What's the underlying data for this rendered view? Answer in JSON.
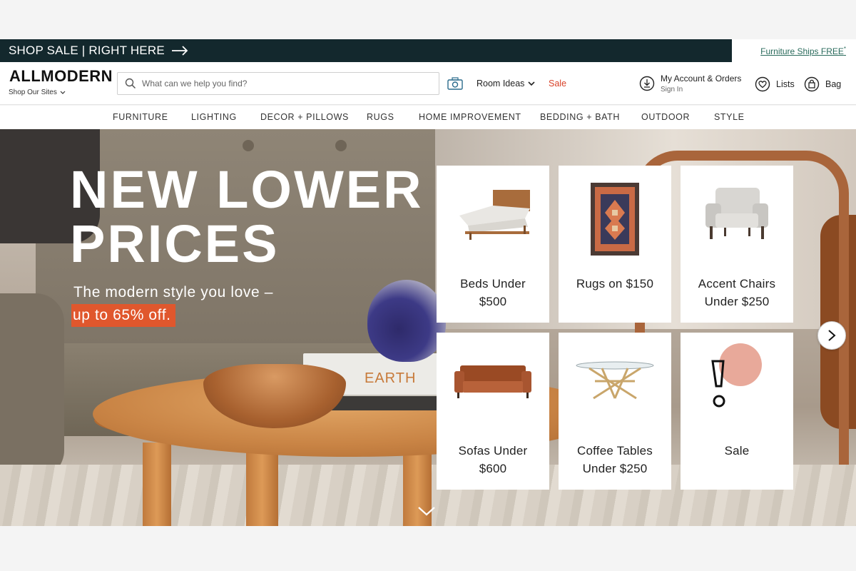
{
  "promo": {
    "left_text": "SHOP SALE | RIGHT HERE",
    "right_text": "Furniture Ships FREE",
    "right_mark": "*"
  },
  "header": {
    "logo": "ALLMODERN",
    "shop_sites": "Shop Our Sites",
    "search_placeholder": "What can we help you find?",
    "room_ideas": "Room Ideas",
    "sale": "Sale",
    "account_title": "My Account & Orders",
    "account_sub": "Sign In",
    "lists": "Lists",
    "bag": "Bag"
  },
  "nav": {
    "items": [
      "FURNITURE",
      "LIGHTING",
      "DECOR + PILLOWS",
      "RUGS",
      "HOME IMPROVEMENT",
      "BEDDING + BATH",
      "OUTDOOR",
      "STYLE"
    ]
  },
  "hero": {
    "title_line1": "NEW LOWER",
    "title_line2": "PRICES",
    "sub_line1": "The modern style you love –",
    "sub_line2": "up to 65% off.",
    "book_label": "EARTH"
  },
  "tiles": [
    {
      "line1": "Beds Under",
      "line2": "$500",
      "icon": "bed-image"
    },
    {
      "line1": "Rugs on $150",
      "line2": "",
      "icon": "rug-image"
    },
    {
      "line1": "Accent Chairs",
      "line2": "Under $250",
      "icon": "accent-chair-image"
    },
    {
      "line1": "Sofas Under",
      "line2": "$600",
      "icon": "sofa-image"
    },
    {
      "line1": "Coffee Tables",
      "line2": "Under $250",
      "icon": "coffee-table-image"
    },
    {
      "line1": "Sale",
      "line2": "",
      "icon": "sale-exclamation-icon"
    }
  ],
  "colors": {
    "promo_bar": "#13282d",
    "sale_red": "#d9432a",
    "highlight_orange": "#e0572d",
    "ships_free_green": "#2a6b5c"
  }
}
